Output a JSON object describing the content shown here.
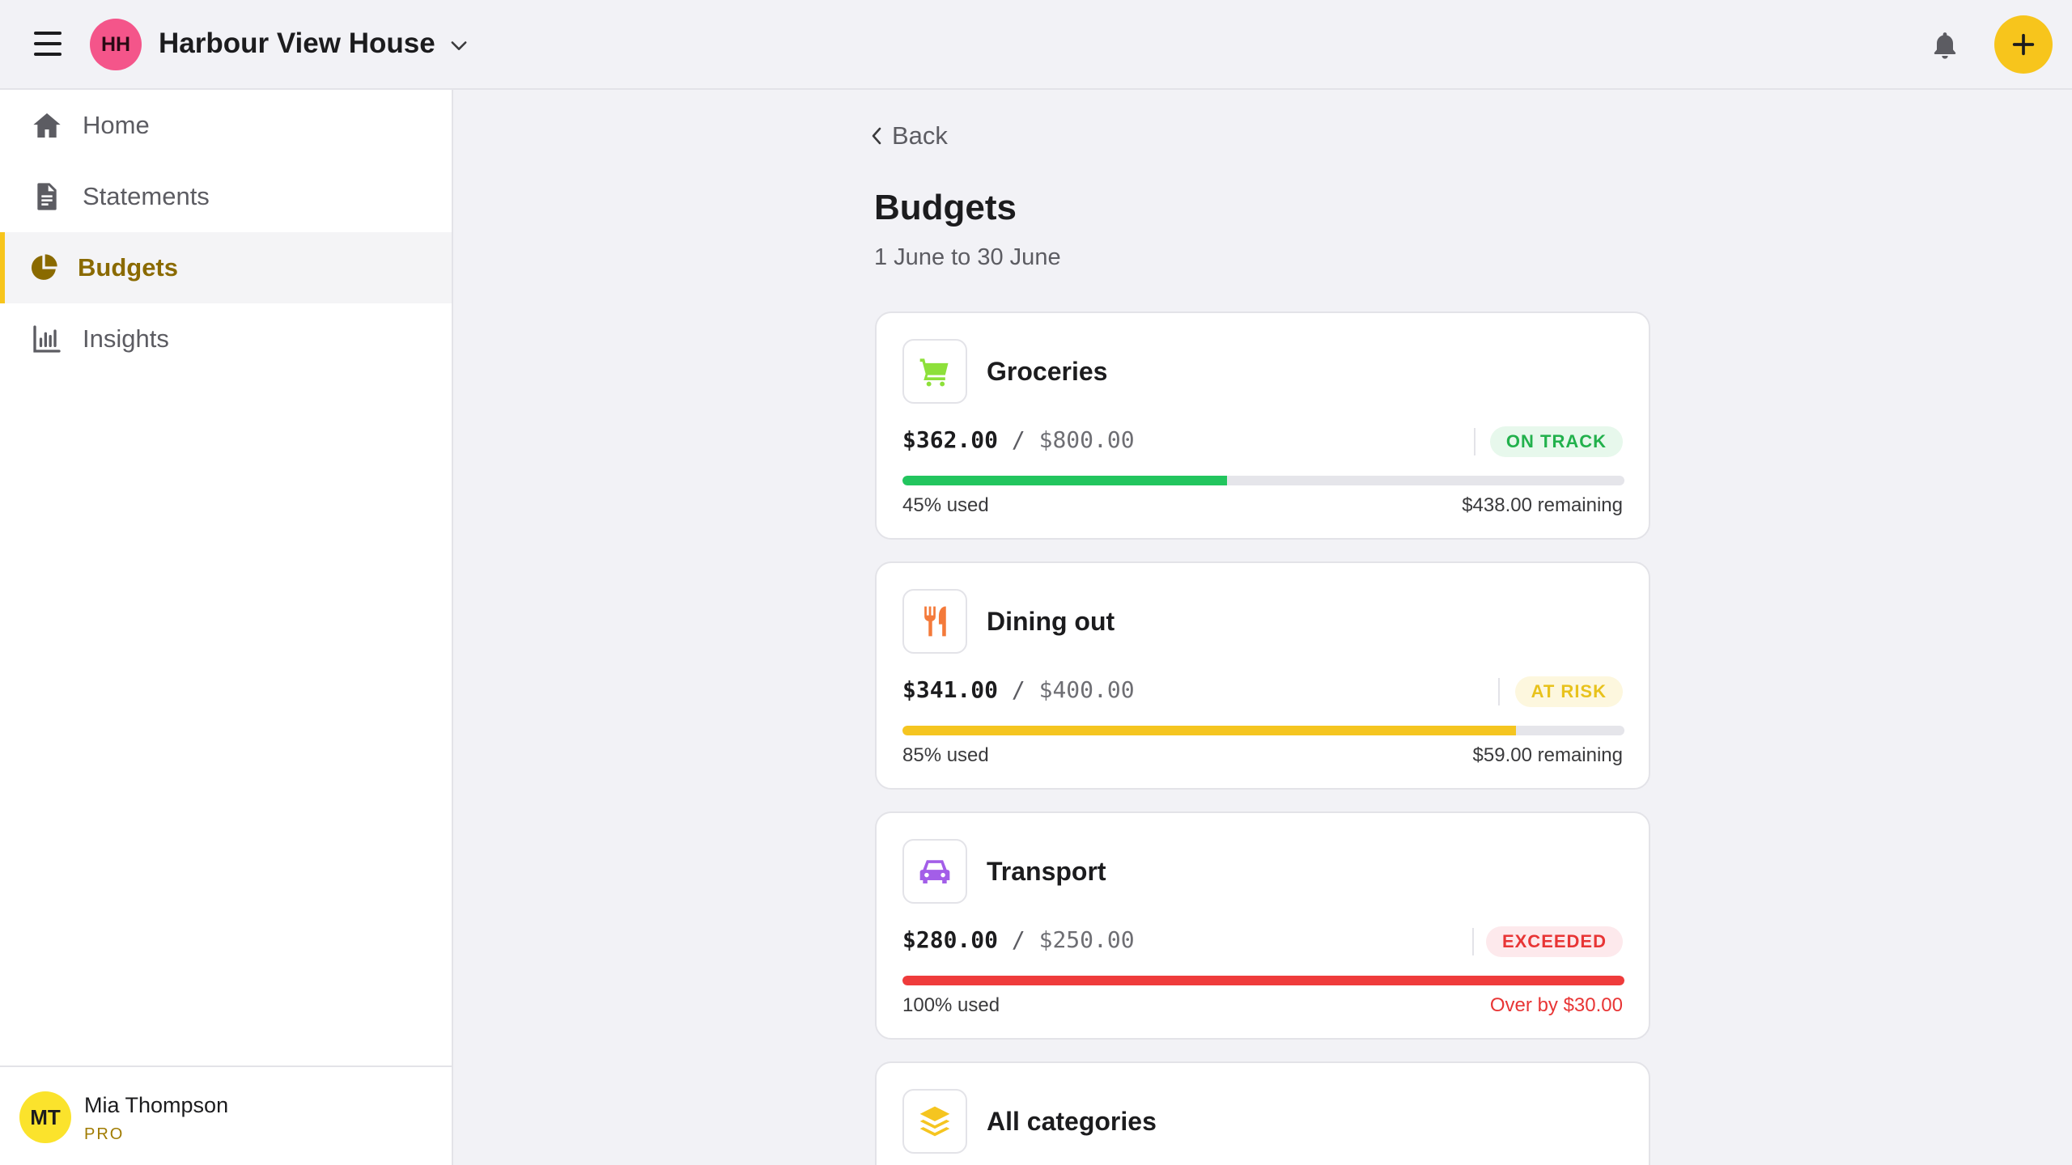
{
  "header": {
    "org_initials": "HH",
    "org_name": "Harbour View House"
  },
  "sidebar": {
    "items": [
      {
        "label": "Home",
        "icon": "home-icon"
      },
      {
        "label": "Statements",
        "icon": "document-icon"
      },
      {
        "label": "Budgets",
        "icon": "pie-chart-icon",
        "active": true
      },
      {
        "label": "Insights",
        "icon": "bar-chart-icon"
      }
    ]
  },
  "user": {
    "initials": "MT",
    "name": "Mia Thompson",
    "plan": "PRO"
  },
  "page": {
    "back_label": "Back",
    "title": "Budgets",
    "date_range": "1 June to 30 June"
  },
  "budgets": [
    {
      "name": "Groceries",
      "icon": "cart-icon",
      "spent": "$362.00",
      "total": "$800.00",
      "status": "ON TRACK",
      "status_color": "#22b14c",
      "progress": 0.45,
      "used": "45% used",
      "remaining": "$438.00 remaining"
    },
    {
      "name": "Dining out",
      "icon": "utensils-icon",
      "spent": "$341.00",
      "total": "$400.00",
      "status": "AT RISK",
      "status_color": "#e8c21c",
      "progress": 0.85,
      "used": "85% used",
      "remaining": "$59.00 remaining"
    },
    {
      "name": "Transport",
      "icon": "car-icon",
      "spent": "$280.00",
      "total": "$250.00",
      "status": "EXCEEDED",
      "status_color": "#e83535",
      "progress": 1.0,
      "used": "100% used",
      "remaining": "Over by $30.00"
    },
    {
      "name": "All categories",
      "icon": "layers-icon"
    }
  ],
  "colors": {
    "accent": "#f7c51c",
    "org_avatar": "#f4558a",
    "user_avatar": "#fbe32c",
    "green": "#22c55e",
    "yellow": "#f5c520",
    "red": "#ef3b3b"
  }
}
